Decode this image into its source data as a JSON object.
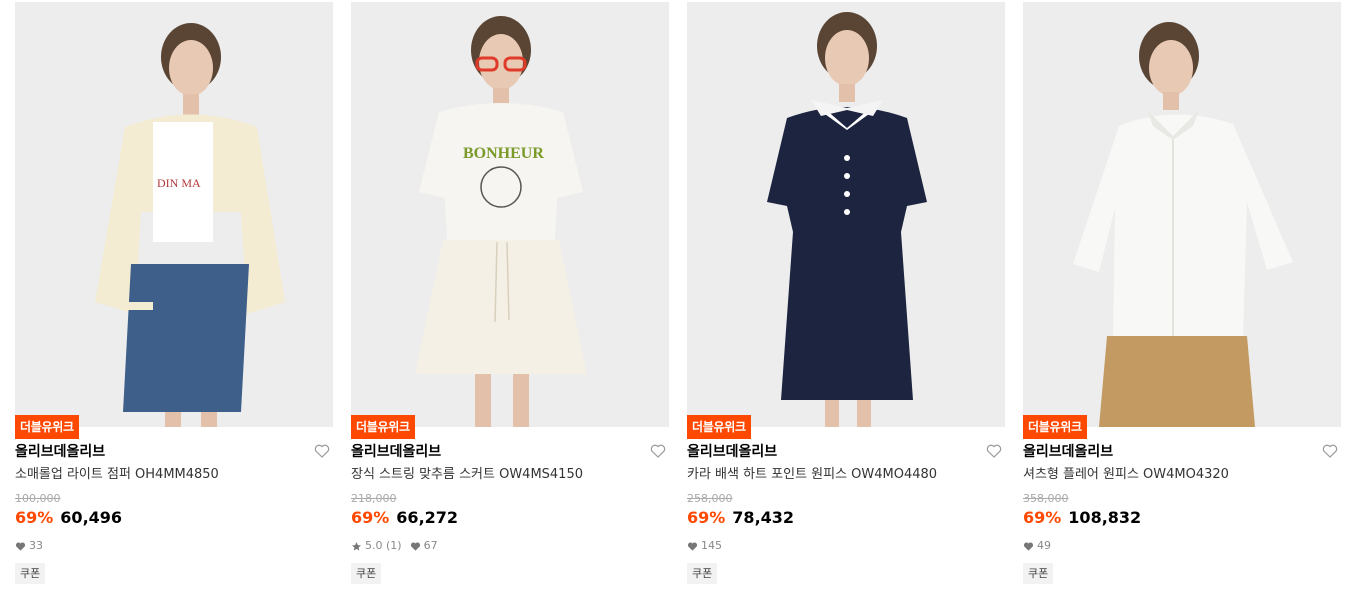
{
  "products": [
    {
      "badge": "더블유위크",
      "brand": "올리브데올리브",
      "name": "소매롤업 라이트 점퍼 OH4MM4850",
      "original_price": "100,000",
      "discount": "69%",
      "price": "60,496",
      "rating": "",
      "likes": "33",
      "tag": "쿠폰",
      "image_desc": "model-cream-jacket-denim-skirt"
    },
    {
      "badge": "더블유위크",
      "brand": "올리브데올리브",
      "name": "장식 스트링 맞추름 스커트 OW4MS4150",
      "original_price": "218,000",
      "discount": "69%",
      "price": "66,272",
      "rating": "5.0 (1)",
      "likes": "67",
      "tag": "쿠폰",
      "image_desc": "model-white-tee-textured-skirt"
    },
    {
      "badge": "더블유위크",
      "brand": "올리브데올리브",
      "name": "카라 배색 하트 포인트 원피스 OW4MO4480",
      "original_price": "258,000",
      "discount": "69%",
      "price": "78,432",
      "rating": "",
      "likes": "145",
      "tag": "쿠폰",
      "image_desc": "model-navy-dress-white-collar"
    },
    {
      "badge": "더블유위크",
      "brand": "올리브데올리브",
      "name": "셔츠형 플레어 원피스 OW4MO4320",
      "original_price": "358,000",
      "discount": "69%",
      "price": "108,832",
      "rating": "",
      "likes": "49",
      "tag": "쿠폰",
      "image_desc": "model-white-blouse-beige-pants"
    }
  ],
  "colors": {
    "accent": "#ff4800",
    "image_bg": "#ededed"
  },
  "icons": {
    "wishlist": "heart-outline-icon",
    "likes": "heart-filled-icon",
    "rating": "star-icon"
  }
}
